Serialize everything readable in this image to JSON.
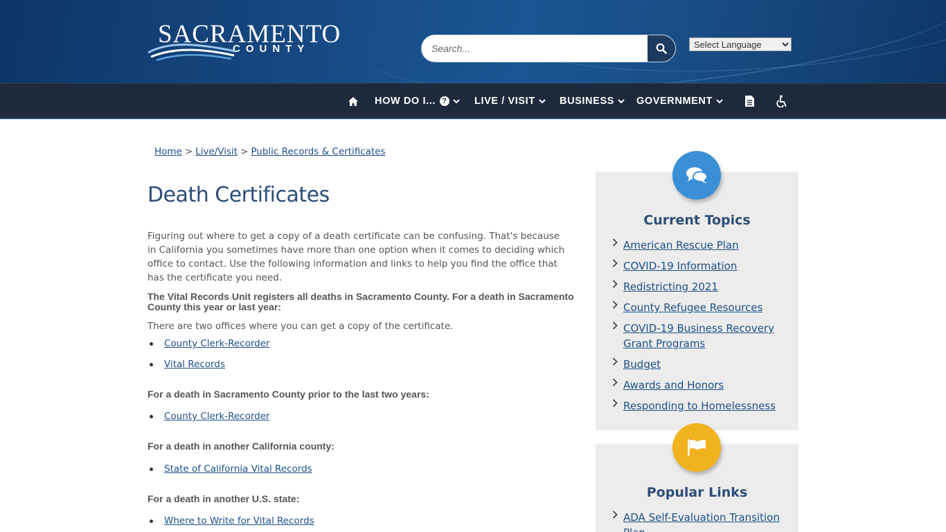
{
  "header": {
    "logo_main": "SACRAMENTO",
    "logo_sub": "COUNTY",
    "search_placeholder": "Search...",
    "language_label": "Select Language"
  },
  "nav": {
    "items": [
      {
        "label": "HOW DO I..."
      },
      {
        "label": "LIVE / VISIT"
      },
      {
        "label": "BUSINESS"
      },
      {
        "label": "GOVERNMENT"
      }
    ]
  },
  "breadcrumb": {
    "items": [
      "Home",
      "Live/Visit",
      "Public Records & Certificates"
    ],
    "separator": ">"
  },
  "main": {
    "title": "Death Certificates",
    "intro": "Figuring out where to get a copy of a death certificate can be confusing. That's because in California you sometimes have more than one option when it comes to deciding which office to contact. Use the following information and links to help you find the office that has the certificate you need.",
    "sections": [
      {
        "heading": "The Vital Records Unit registers all deaths in Sacramento County. For a death in Sacramento County this year or last year:",
        "text": "There are two offices where you can get a copy of the certificate.",
        "links": [
          "County Clerk-Recorder",
          "Vital Records"
        ]
      },
      {
        "heading": "For a death in Sacramento County prior to the last two years:",
        "links": [
          "County Clerk-Recorder"
        ]
      },
      {
        "heading": "For a death in another California county:",
        "links": [
          "State of California Vital Records"
        ]
      },
      {
        "heading": "For a death in another U.S. state:",
        "links": [
          "Where to Write for Vital Records"
        ]
      }
    ]
  },
  "sidebar": {
    "current_topics": {
      "title": "Current Topics",
      "icon": "comments-icon",
      "color": "#3b8fd6",
      "links": [
        "American Rescue Plan",
        "COVID-19 Information",
        "Redistricting 2021",
        "County Refugee Resources",
        "COVID-19 Business Recovery Grant Programs",
        "Budget",
        "Awards and Honors",
        "Responding to Homelessness"
      ]
    },
    "popular_links": {
      "title": "Popular Links",
      "icon": "flag-icon",
      "color": "#f0b21e",
      "links": [
        "ADA Self-Evaluation Transition Plan"
      ]
    }
  },
  "colors": {
    "header_bg": "#174a85",
    "nav_bg": "#1e2a3c",
    "link": "#1d4f86",
    "title": "#2c4d77"
  }
}
